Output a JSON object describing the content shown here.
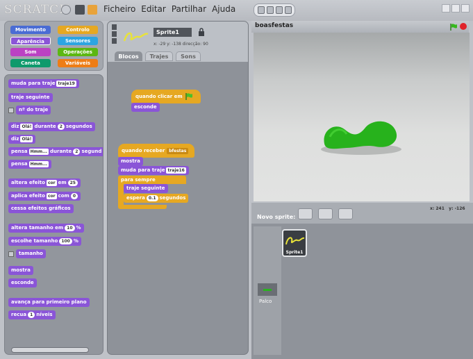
{
  "app": {
    "logo": "SCRATCH"
  },
  "menu": [
    "Ficheiro",
    "Editar",
    "Partilhar",
    "Ajuda"
  ],
  "categories": [
    {
      "label": "Movimento",
      "color": "#4a6cd4"
    },
    {
      "label": "Controlo",
      "color": "#e6a822"
    },
    {
      "label": "Aparência",
      "color": "#8a55d7"
    },
    {
      "label": "Sensores",
      "color": "#2ca5e2"
    },
    {
      "label": "Som",
      "color": "#bb42c3"
    },
    {
      "label": "Operações",
      "color": "#5cb712"
    },
    {
      "label": "Caneta",
      "color": "#0e9a6c"
    },
    {
      "label": "Variáveis",
      "color": "#ee7d16"
    }
  ],
  "palette": {
    "b1": "muda para traje",
    "b1_in": "traje19",
    "b2": "traje seguinte",
    "b3": "nº do traje",
    "b4a": "diz",
    "b4_in": "Olá!",
    "b4b": "durante",
    "b4_num": "2",
    "b4c": "segundos",
    "b5a": "diz",
    "b5_in": "Olá!",
    "b6a": "pensa",
    "b6_in": "Hmm...",
    "b6b": "durante",
    "b6_num": "2",
    "b6c": "segund",
    "b7a": "pensa",
    "b7_in": "Hmm...",
    "b8a": "altera efeito",
    "b8_in": "cor",
    "b8b": "em",
    "b8_num": "25",
    "b9a": "aplica efeito",
    "b9_in": "cor",
    "b9b": "com",
    "b9_num": "0",
    "b10": "cessa efeitos gráficos",
    "b11a": "altera tamanho em",
    "b11_num": "10",
    "b11b": "%",
    "b12a": "escolhe tamanho",
    "b12_num": "100",
    "b12b": "%",
    "b13": "tamanho",
    "b14": "mostra",
    "b15": "esconde",
    "b16": "avança para primeiro plano",
    "b17a": "recua",
    "b17_num": "1",
    "b17b": "níveis"
  },
  "sprite": {
    "name": "Sprite1",
    "coords": "x: -29   y: -138  direcção: 90"
  },
  "tabs": [
    "Blocos",
    "Trajes",
    "Sons"
  ],
  "scripts": {
    "s1_hat": "quando clicar em",
    "s1_b1": "esconde",
    "s2_hat": "quando receber",
    "s2_hat_in": "bfestas",
    "s2_b1": "mostra",
    "s2_b2": "muda para traje",
    "s2_b2_in": "traje16",
    "s2_loop": "para sempre",
    "s2_b3": "traje seguinte",
    "s2_b4a": "espera",
    "s2_b4_num": "0.1",
    "s2_b4b": "segundos"
  },
  "stage": {
    "title": "boasfestas"
  },
  "bottom": {
    "newsprite": "Novo sprite:",
    "mouse_x": "x: 241",
    "mouse_y": "y: -126",
    "sprite_label": "Sprite1",
    "stage_label": "Palco"
  }
}
